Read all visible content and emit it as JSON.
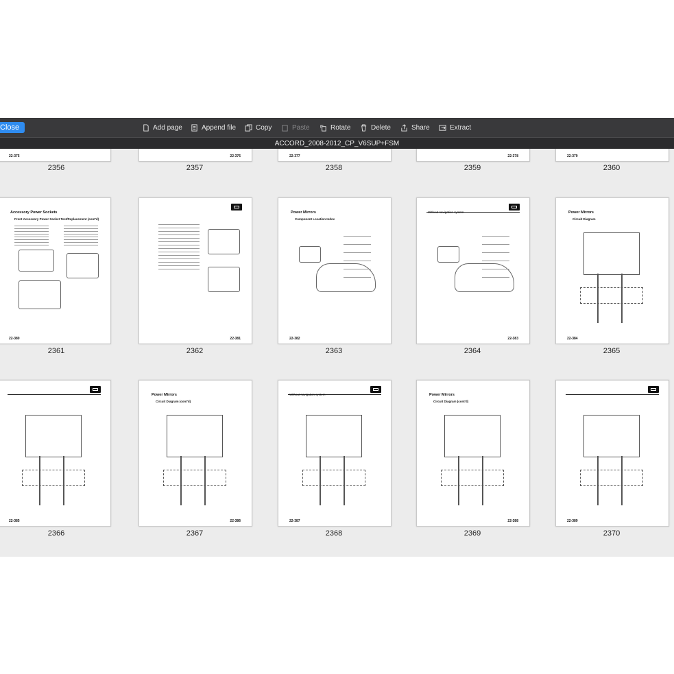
{
  "toolbar": {
    "close_label": "Close",
    "items": [
      {
        "label": "Add page",
        "icon": "add-page-icon",
        "enabled": true
      },
      {
        "label": "Append file",
        "icon": "append-file-icon",
        "enabled": true
      },
      {
        "label": "Copy",
        "icon": "copy-icon",
        "enabled": true
      },
      {
        "label": "Paste",
        "icon": "paste-icon",
        "enabled": false
      },
      {
        "label": "Rotate",
        "icon": "rotate-icon",
        "enabled": true
      },
      {
        "label": "Delete",
        "icon": "trash-icon",
        "enabled": true
      },
      {
        "label": "Share",
        "icon": "share-icon",
        "enabled": true
      },
      {
        "label": "Extract",
        "icon": "extract-icon",
        "enabled": true
      }
    ]
  },
  "document": {
    "title": "ACCORD_2008-2012_CP_V6SUP+FSM"
  },
  "rows": [
    {
      "pages": [
        {
          "number": "2356",
          "footer": "22-375"
        },
        {
          "number": "2357",
          "footer": "22-376"
        },
        {
          "number": "2358",
          "footer": "22-377"
        },
        {
          "number": "2359",
          "footer": "22-378"
        },
        {
          "number": "2360",
          "footer": "22-379"
        }
      ]
    },
    {
      "pages": [
        {
          "number": "2361",
          "footer": "22-380",
          "title": "Accessory Power Sockets",
          "subtitle": "Front Accessory Power Socket Test/Replacement (cont'd)"
        },
        {
          "number": "2362",
          "footer": "22-381",
          "title": "",
          "subtitle": ""
        },
        {
          "number": "2363",
          "footer": "22-382",
          "title": "Power Mirrors",
          "subtitle": "Component Location Index"
        },
        {
          "number": "2364",
          "footer": "22-383",
          "title": "",
          "subtitle": "Without navigation system"
        },
        {
          "number": "2365",
          "footer": "22-384",
          "title": "Power Mirrors",
          "subtitle": "Circuit Diagram"
        }
      ]
    },
    {
      "pages": [
        {
          "number": "2366",
          "footer": "22-385",
          "title": "",
          "subtitle": ""
        },
        {
          "number": "2367",
          "footer": "22-386",
          "title": "Power Mirrors",
          "subtitle": "Circuit Diagram (cont'd)"
        },
        {
          "number": "2368",
          "footer": "22-387",
          "title": "",
          "subtitle": "Without navigation system"
        },
        {
          "number": "2369",
          "footer": "22-388",
          "title": "Power Mirrors",
          "subtitle": "Circuit Diagram (cont'd)"
        },
        {
          "number": "2370",
          "footer": "22-389",
          "title": "",
          "subtitle": ""
        }
      ]
    }
  ]
}
